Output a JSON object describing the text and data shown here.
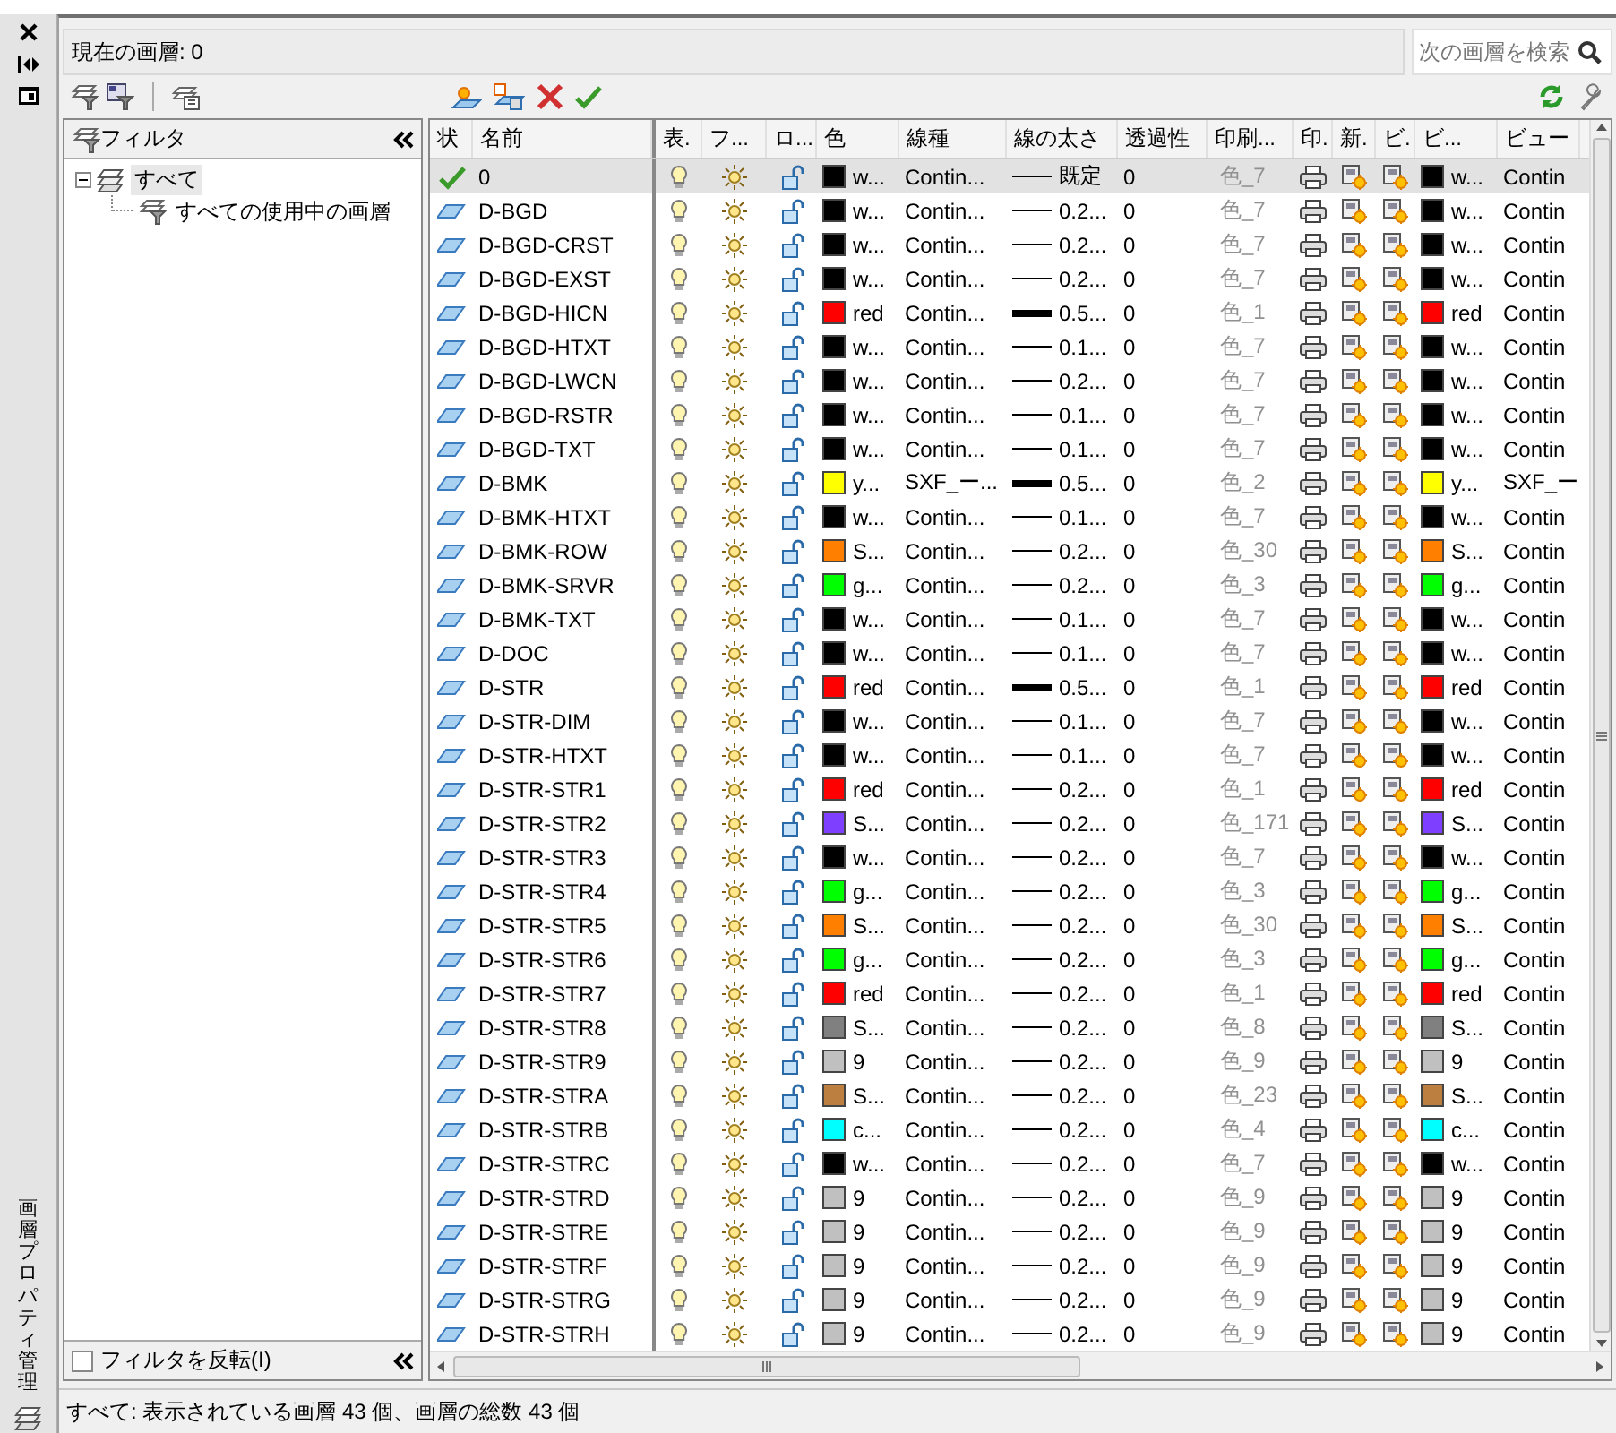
{
  "palette": {
    "title": "画層プロパティ管理"
  },
  "current_layer": "現在の画層: 0",
  "search": {
    "placeholder": "次の画層を検索"
  },
  "filter_pane": {
    "title": "フィルタ",
    "tree": [
      {
        "label": "すべて",
        "selected": true,
        "expanded": true,
        "children": [
          {
            "label": "すべての使用中の画層",
            "selected": false
          }
        ]
      }
    ],
    "invert_filter": {
      "label": "フィルタを反転(I)",
      "checked": false
    }
  },
  "columns": [
    "状",
    "名前",
    "表.",
    "フ...",
    "ロ...",
    "色",
    "線種",
    "線の太さ",
    "透過性",
    "印刷...",
    "印.",
    "新.",
    "ビ.",
    "ビ...",
    "ビュー"
  ],
  "layers": [
    {
      "kind": "current",
      "name": "0",
      "selected": true,
      "on": true,
      "frozen": false,
      "locked": false,
      "color": "#000000",
      "color_name": "w...",
      "linetype": "Contin...",
      "heavy": false,
      "lineweight": "既定",
      "transparency": "0",
      "plot_style": "色_7",
      "plot": true,
      "vp": {
        "color": "#000000",
        "color_name": "w...",
        "linetype": "Contin"
      }
    },
    {
      "kind": "layer",
      "name": "D-BGD",
      "selected": false,
      "on": true,
      "frozen": false,
      "locked": false,
      "color": "#000000",
      "color_name": "w...",
      "linetype": "Contin...",
      "heavy": false,
      "lineweight": "0.2...",
      "transparency": "0",
      "plot_style": "色_7",
      "plot": true,
      "vp": {
        "color": "#000000",
        "color_name": "w...",
        "linetype": "Contin"
      }
    },
    {
      "kind": "layer",
      "name": "D-BGD-CRST",
      "selected": false,
      "on": true,
      "frozen": false,
      "locked": false,
      "color": "#000000",
      "color_name": "w...",
      "linetype": "Contin...",
      "heavy": false,
      "lineweight": "0.2...",
      "transparency": "0",
      "plot_style": "色_7",
      "plot": true,
      "vp": {
        "color": "#000000",
        "color_name": "w...",
        "linetype": "Contin"
      }
    },
    {
      "kind": "layer",
      "name": "D-BGD-EXST",
      "selected": false,
      "on": true,
      "frozen": false,
      "locked": false,
      "color": "#000000",
      "color_name": "w...",
      "linetype": "Contin...",
      "heavy": false,
      "lineweight": "0.2...",
      "transparency": "0",
      "plot_style": "色_7",
      "plot": true,
      "vp": {
        "color": "#000000",
        "color_name": "w...",
        "linetype": "Contin"
      }
    },
    {
      "kind": "layer",
      "name": "D-BGD-HICN",
      "selected": false,
      "on": true,
      "frozen": false,
      "locked": false,
      "color": "#ff0000",
      "color_name": "red",
      "linetype": "Contin...",
      "heavy": true,
      "lineweight": "0.5...",
      "transparency": "0",
      "plot_style": "色_1",
      "plot": true,
      "vp": {
        "color": "#ff0000",
        "color_name": "red",
        "linetype": "Contin"
      }
    },
    {
      "kind": "layer",
      "name": "D-BGD-HTXT",
      "selected": false,
      "on": true,
      "frozen": false,
      "locked": false,
      "color": "#000000",
      "color_name": "w...",
      "linetype": "Contin...",
      "heavy": false,
      "lineweight": "0.1...",
      "transparency": "0",
      "plot_style": "色_7",
      "plot": true,
      "vp": {
        "color": "#000000",
        "color_name": "w...",
        "linetype": "Contin"
      }
    },
    {
      "kind": "layer",
      "name": "D-BGD-LWCN",
      "selected": false,
      "on": true,
      "frozen": false,
      "locked": false,
      "color": "#000000",
      "color_name": "w...",
      "linetype": "Contin...",
      "heavy": false,
      "lineweight": "0.2...",
      "transparency": "0",
      "plot_style": "色_7",
      "plot": true,
      "vp": {
        "color": "#000000",
        "color_name": "w...",
        "linetype": "Contin"
      }
    },
    {
      "kind": "layer",
      "name": "D-BGD-RSTR",
      "selected": false,
      "on": true,
      "frozen": false,
      "locked": false,
      "color": "#000000",
      "color_name": "w...",
      "linetype": "Contin...",
      "heavy": false,
      "lineweight": "0.1...",
      "transparency": "0",
      "plot_style": "色_7",
      "plot": true,
      "vp": {
        "color": "#000000",
        "color_name": "w...",
        "linetype": "Contin"
      }
    },
    {
      "kind": "layer",
      "name": "D-BGD-TXT",
      "selected": false,
      "on": true,
      "frozen": false,
      "locked": false,
      "color": "#000000",
      "color_name": "w...",
      "linetype": "Contin...",
      "heavy": false,
      "lineweight": "0.1...",
      "transparency": "0",
      "plot_style": "色_7",
      "plot": true,
      "vp": {
        "color": "#000000",
        "color_name": "w...",
        "linetype": "Contin"
      }
    },
    {
      "kind": "layer",
      "name": "D-BMK",
      "selected": false,
      "on": true,
      "frozen": false,
      "locked": false,
      "color": "#ffff00",
      "color_name": "y...",
      "linetype": "SXF_ー...",
      "heavy": true,
      "lineweight": "0.5...",
      "transparency": "0",
      "plot_style": "色_2",
      "plot": true,
      "vp": {
        "color": "#ffff00",
        "color_name": "y...",
        "linetype": "SXF_ー"
      }
    },
    {
      "kind": "layer",
      "name": "D-BMK-HTXT",
      "selected": false,
      "on": true,
      "frozen": false,
      "locked": false,
      "color": "#000000",
      "color_name": "w...",
      "linetype": "Contin...",
      "heavy": false,
      "lineweight": "0.1...",
      "transparency": "0",
      "plot_style": "色_7",
      "plot": true,
      "vp": {
        "color": "#000000",
        "color_name": "w...",
        "linetype": "Contin"
      }
    },
    {
      "kind": "layer",
      "name": "D-BMK-ROW",
      "selected": false,
      "on": true,
      "frozen": false,
      "locked": false,
      "color": "#ff7f00",
      "color_name": "S...",
      "linetype": "Contin...",
      "heavy": false,
      "lineweight": "0.2...",
      "transparency": "0",
      "plot_style": "色_30",
      "plot": true,
      "vp": {
        "color": "#ff7f00",
        "color_name": "S...",
        "linetype": "Contin"
      }
    },
    {
      "kind": "layer",
      "name": "D-BMK-SRVR",
      "selected": false,
      "on": true,
      "frozen": false,
      "locked": false,
      "color": "#00ff00",
      "color_name": "g...",
      "linetype": "Contin...",
      "heavy": false,
      "lineweight": "0.2...",
      "transparency": "0",
      "plot_style": "色_3",
      "plot": true,
      "vp": {
        "color": "#00ff00",
        "color_name": "g...",
        "linetype": "Contin"
      }
    },
    {
      "kind": "layer",
      "name": "D-BMK-TXT",
      "selected": false,
      "on": true,
      "frozen": false,
      "locked": false,
      "color": "#000000",
      "color_name": "w...",
      "linetype": "Contin...",
      "heavy": false,
      "lineweight": "0.1...",
      "transparency": "0",
      "plot_style": "色_7",
      "plot": true,
      "vp": {
        "color": "#000000",
        "color_name": "w...",
        "linetype": "Contin"
      }
    },
    {
      "kind": "layer",
      "name": "D-DOC",
      "selected": false,
      "on": true,
      "frozen": false,
      "locked": false,
      "color": "#000000",
      "color_name": "w...",
      "linetype": "Contin...",
      "heavy": false,
      "lineweight": "0.1...",
      "transparency": "0",
      "plot_style": "色_7",
      "plot": true,
      "vp": {
        "color": "#000000",
        "color_name": "w...",
        "linetype": "Contin"
      }
    },
    {
      "kind": "layer",
      "name": "D-STR",
      "selected": false,
      "on": true,
      "frozen": false,
      "locked": false,
      "color": "#ff0000",
      "color_name": "red",
      "linetype": "Contin...",
      "heavy": true,
      "lineweight": "0.5...",
      "transparency": "0",
      "plot_style": "色_1",
      "plot": true,
      "vp": {
        "color": "#ff0000",
        "color_name": "red",
        "linetype": "Contin"
      }
    },
    {
      "kind": "layer",
      "name": "D-STR-DIM",
      "selected": false,
      "on": true,
      "frozen": false,
      "locked": false,
      "color": "#000000",
      "color_name": "w...",
      "linetype": "Contin...",
      "heavy": false,
      "lineweight": "0.1...",
      "transparency": "0",
      "plot_style": "色_7",
      "plot": true,
      "vp": {
        "color": "#000000",
        "color_name": "w...",
        "linetype": "Contin"
      }
    },
    {
      "kind": "layer",
      "name": "D-STR-HTXT",
      "selected": false,
      "on": true,
      "frozen": false,
      "locked": false,
      "color": "#000000",
      "color_name": "w...",
      "linetype": "Contin...",
      "heavy": false,
      "lineweight": "0.1...",
      "transparency": "0",
      "plot_style": "色_7",
      "plot": true,
      "vp": {
        "color": "#000000",
        "color_name": "w...",
        "linetype": "Contin"
      }
    },
    {
      "kind": "layer",
      "name": "D-STR-STR1",
      "selected": false,
      "on": true,
      "frozen": false,
      "locked": false,
      "color": "#ff0000",
      "color_name": "red",
      "linetype": "Contin...",
      "heavy": false,
      "lineweight": "0.2...",
      "transparency": "0",
      "plot_style": "色_1",
      "plot": true,
      "vp": {
        "color": "#ff0000",
        "color_name": "red",
        "linetype": "Contin"
      }
    },
    {
      "kind": "layer",
      "name": "D-STR-STR2",
      "selected": false,
      "on": true,
      "frozen": false,
      "locked": false,
      "color": "#7f3fff",
      "color_name": "S...",
      "linetype": "Contin...",
      "heavy": false,
      "lineweight": "0.2...",
      "transparency": "0",
      "plot_style": "色_171",
      "plot": true,
      "vp": {
        "color": "#7f3fff",
        "color_name": "S...",
        "linetype": "Contin"
      }
    },
    {
      "kind": "layer",
      "name": "D-STR-STR3",
      "selected": false,
      "on": true,
      "frozen": false,
      "locked": false,
      "color": "#000000",
      "color_name": "w...",
      "linetype": "Contin...",
      "heavy": false,
      "lineweight": "0.2...",
      "transparency": "0",
      "plot_style": "色_7",
      "plot": true,
      "vp": {
        "color": "#000000",
        "color_name": "w...",
        "linetype": "Contin"
      }
    },
    {
      "kind": "layer",
      "name": "D-STR-STR4",
      "selected": false,
      "on": true,
      "frozen": false,
      "locked": false,
      "color": "#00ff00",
      "color_name": "g...",
      "linetype": "Contin...",
      "heavy": false,
      "lineweight": "0.2...",
      "transparency": "0",
      "plot_style": "色_3",
      "plot": true,
      "vp": {
        "color": "#00ff00",
        "color_name": "g...",
        "linetype": "Contin"
      }
    },
    {
      "kind": "layer",
      "name": "D-STR-STR5",
      "selected": false,
      "on": true,
      "frozen": false,
      "locked": false,
      "color": "#ff7f00",
      "color_name": "S...",
      "linetype": "Contin...",
      "heavy": false,
      "lineweight": "0.2...",
      "transparency": "0",
      "plot_style": "色_30",
      "plot": true,
      "vp": {
        "color": "#ff7f00",
        "color_name": "S...",
        "linetype": "Contin"
      }
    },
    {
      "kind": "layer",
      "name": "D-STR-STR6",
      "selected": false,
      "on": true,
      "frozen": false,
      "locked": false,
      "color": "#00ff00",
      "color_name": "g...",
      "linetype": "Contin...",
      "heavy": false,
      "lineweight": "0.2...",
      "transparency": "0",
      "plot_style": "色_3",
      "plot": true,
      "vp": {
        "color": "#00ff00",
        "color_name": "g...",
        "linetype": "Contin"
      }
    },
    {
      "kind": "layer",
      "name": "D-STR-STR7",
      "selected": false,
      "on": true,
      "frozen": false,
      "locked": false,
      "color": "#ff0000",
      "color_name": "red",
      "linetype": "Contin...",
      "heavy": false,
      "lineweight": "0.2...",
      "transparency": "0",
      "plot_style": "色_1",
      "plot": true,
      "vp": {
        "color": "#ff0000",
        "color_name": "red",
        "linetype": "Contin"
      }
    },
    {
      "kind": "layer",
      "name": "D-STR-STR8",
      "selected": false,
      "on": true,
      "frozen": false,
      "locked": false,
      "color": "#808080",
      "color_name": "S...",
      "linetype": "Contin...",
      "heavy": false,
      "lineweight": "0.2...",
      "transparency": "0",
      "plot_style": "色_8",
      "plot": true,
      "vp": {
        "color": "#808080",
        "color_name": "S...",
        "linetype": "Contin"
      }
    },
    {
      "kind": "layer",
      "name": "D-STR-STR9",
      "selected": false,
      "on": true,
      "frozen": false,
      "locked": false,
      "color": "#c0c0c0",
      "color_name": "9",
      "linetype": "Contin...",
      "heavy": false,
      "lineweight": "0.2...",
      "transparency": "0",
      "plot_style": "色_9",
      "plot": true,
      "vp": {
        "color": "#c0c0c0",
        "color_name": "9",
        "linetype": "Contin"
      }
    },
    {
      "kind": "layer",
      "name": "D-STR-STRA",
      "selected": false,
      "on": true,
      "frozen": false,
      "locked": false,
      "color": "#bd7f3f",
      "color_name": "S...",
      "linetype": "Contin...",
      "heavy": false,
      "lineweight": "0.2...",
      "transparency": "0",
      "plot_style": "色_23",
      "plot": true,
      "vp": {
        "color": "#bd7f3f",
        "color_name": "S...",
        "linetype": "Contin"
      }
    },
    {
      "kind": "layer",
      "name": "D-STR-STRB",
      "selected": false,
      "on": true,
      "frozen": false,
      "locked": false,
      "color": "#00ffff",
      "color_name": "c...",
      "linetype": "Contin...",
      "heavy": false,
      "lineweight": "0.2...",
      "transparency": "0",
      "plot_style": "色_4",
      "plot": true,
      "vp": {
        "color": "#00ffff",
        "color_name": "c...",
        "linetype": "Contin"
      }
    },
    {
      "kind": "layer",
      "name": "D-STR-STRC",
      "selected": false,
      "on": true,
      "frozen": false,
      "locked": false,
      "color": "#000000",
      "color_name": "w...",
      "linetype": "Contin...",
      "heavy": false,
      "lineweight": "0.2...",
      "transparency": "0",
      "plot_style": "色_7",
      "plot": true,
      "vp": {
        "color": "#000000",
        "color_name": "w...",
        "linetype": "Contin"
      }
    },
    {
      "kind": "layer",
      "name": "D-STR-STRD",
      "selected": false,
      "on": true,
      "frozen": false,
      "locked": false,
      "color": "#c0c0c0",
      "color_name": "9",
      "linetype": "Contin...",
      "heavy": false,
      "lineweight": "0.2...",
      "transparency": "0",
      "plot_style": "色_9",
      "plot": true,
      "vp": {
        "color": "#c0c0c0",
        "color_name": "9",
        "linetype": "Contin"
      }
    },
    {
      "kind": "layer",
      "name": "D-STR-STRE",
      "selected": false,
      "on": true,
      "frozen": false,
      "locked": false,
      "color": "#c0c0c0",
      "color_name": "9",
      "linetype": "Contin...",
      "heavy": false,
      "lineweight": "0.2...",
      "transparency": "0",
      "plot_style": "色_9",
      "plot": true,
      "vp": {
        "color": "#c0c0c0",
        "color_name": "9",
        "linetype": "Contin"
      }
    },
    {
      "kind": "layer",
      "name": "D-STR-STRF",
      "selected": false,
      "on": true,
      "frozen": false,
      "locked": false,
      "color": "#c0c0c0",
      "color_name": "9",
      "linetype": "Contin...",
      "heavy": false,
      "lineweight": "0.2...",
      "transparency": "0",
      "plot_style": "色_9",
      "plot": true,
      "vp": {
        "color": "#c0c0c0",
        "color_name": "9",
        "linetype": "Contin"
      }
    },
    {
      "kind": "layer",
      "name": "D-STR-STRG",
      "selected": false,
      "on": true,
      "frozen": false,
      "locked": false,
      "color": "#c0c0c0",
      "color_name": "9",
      "linetype": "Contin...",
      "heavy": false,
      "lineweight": "0.2...",
      "transparency": "0",
      "plot_style": "色_9",
      "plot": true,
      "vp": {
        "color": "#c0c0c0",
        "color_name": "9",
        "linetype": "Contin"
      }
    },
    {
      "kind": "layer",
      "name": "D-STR-STRH",
      "selected": false,
      "on": true,
      "frozen": false,
      "locked": false,
      "color": "#c0c0c0",
      "color_name": "9",
      "linetype": "Contin...",
      "heavy": false,
      "lineweight": "0.2...",
      "transparency": "0",
      "plot_style": "色_9",
      "plot": true,
      "vp": {
        "color": "#c0c0c0",
        "color_name": "9",
        "linetype": "Contin"
      }
    }
  ],
  "status_bar": "すべて: 表示されている画層 43 個、画層の総数 43 個"
}
